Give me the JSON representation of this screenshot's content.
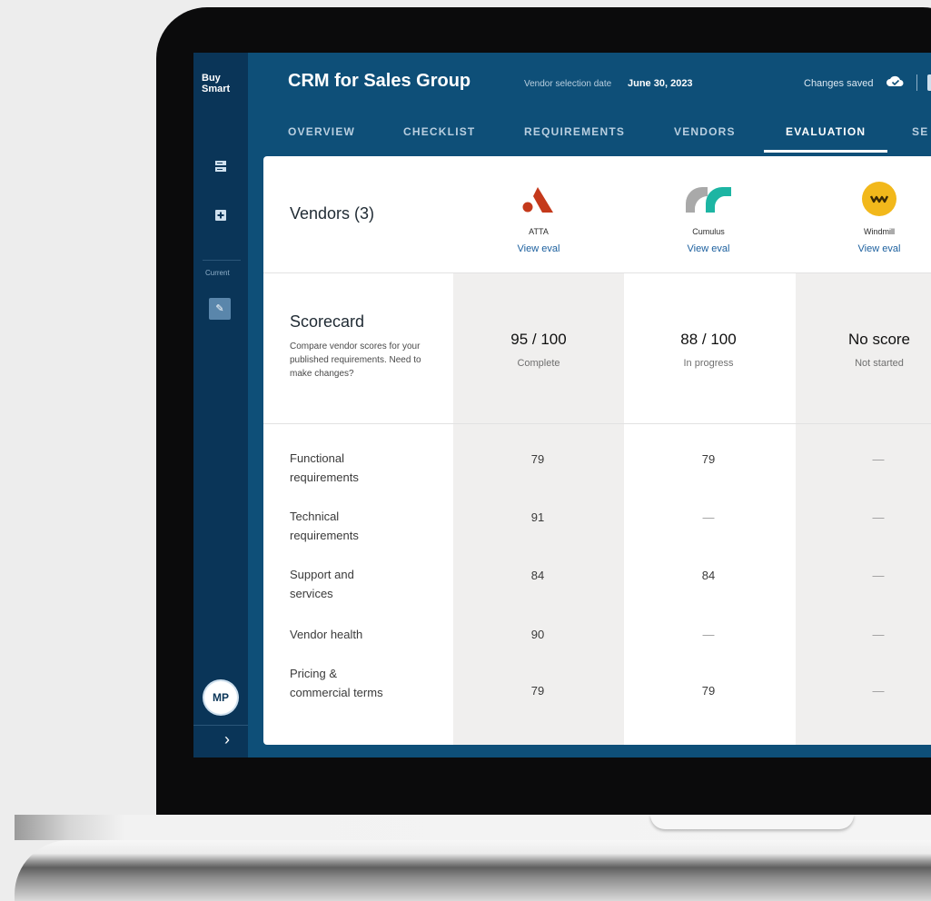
{
  "brand": {
    "line1": "Buy",
    "line2": "Smart"
  },
  "sidebar": {
    "current_label": "Current",
    "avatar_initials": "MP"
  },
  "header": {
    "title": "CRM for Sales Group",
    "vendor_selection_label": "Vendor selection date",
    "vendor_selection_date": "June 30, 2023",
    "save_status": "Changes saved"
  },
  "tabs": [
    {
      "label": "OVERVIEW"
    },
    {
      "label": "CHECKLIST"
    },
    {
      "label": "REQUIREMENTS"
    },
    {
      "label": "VENDORS"
    },
    {
      "label": "EVALUATION"
    },
    {
      "label": "SE"
    }
  ],
  "active_tab": "EVALUATION",
  "vendors": {
    "title": "Vendors (3)",
    "link_label": "View eval",
    "items": [
      {
        "name": "ATTA",
        "logo_icon": "atta-logo-icon",
        "color": "#c4391b"
      },
      {
        "name": "Cumulus",
        "logo_icon": "cumulus-logo-icon",
        "color": "#1db5a3"
      },
      {
        "name": "Windmill",
        "logo_icon": "windmill-logo-icon",
        "color": "#f2b81b"
      }
    ]
  },
  "scorecard": {
    "title": "Scorecard",
    "description": "Compare vendor scores for your published requirements. Need to make changes?",
    "scores": [
      {
        "value": "95 / 100",
        "status": "Complete"
      },
      {
        "value": "88 / 100",
        "status": "In progress"
      },
      {
        "value": "No score",
        "status": "Not started"
      }
    ]
  },
  "requirements": [
    {
      "line1": "Functional",
      "line2": "requirements",
      "values": [
        "79",
        "79",
        "—"
      ]
    },
    {
      "line1": "Technical",
      "line2": "requirements",
      "values": [
        "91",
        "—",
        "—"
      ]
    },
    {
      "line1": "Support and",
      "line2": "services",
      "values": [
        "84",
        "84",
        "—"
      ]
    },
    {
      "line1": "Vendor health",
      "line2": "",
      "values": [
        "90",
        "—",
        "—"
      ]
    },
    {
      "line1": "Pricing &",
      "line2": "commercial terms",
      "values": [
        "79",
        "79",
        "—"
      ]
    }
  ]
}
